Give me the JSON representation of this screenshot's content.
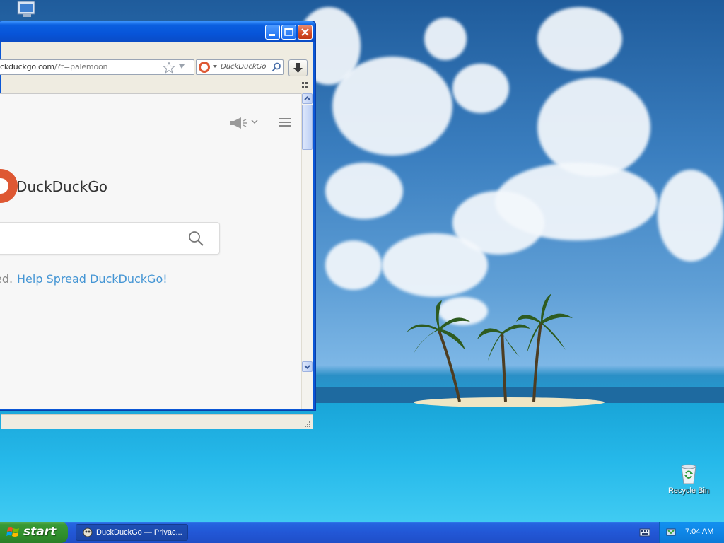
{
  "window": {
    "minimize_label": "minimize",
    "maximize_label": "maximize",
    "close_label": "close"
  },
  "navbar": {
    "url_prefix": "ckduckgo.com",
    "url_suffix": "/?t=palemoon",
    "search_placeholder": "DuckDuckGo"
  },
  "page": {
    "brand_name": "DuckDuckGo",
    "spread_prefix": "ed.",
    "spread_link": "Help Spread DuckDuckGo!"
  },
  "desktop": {
    "recycle_bin_label": "Recycle Bin"
  },
  "taskbar": {
    "start_label": "start",
    "task_label": "DuckDuckGo — Privac...",
    "clock": "7:04 AM"
  },
  "colors": {
    "ddg_orange": "#de5833",
    "link_blue": "#4495d4",
    "titlebar_blue": "#0754d8",
    "start_green": "#3a9a36"
  }
}
